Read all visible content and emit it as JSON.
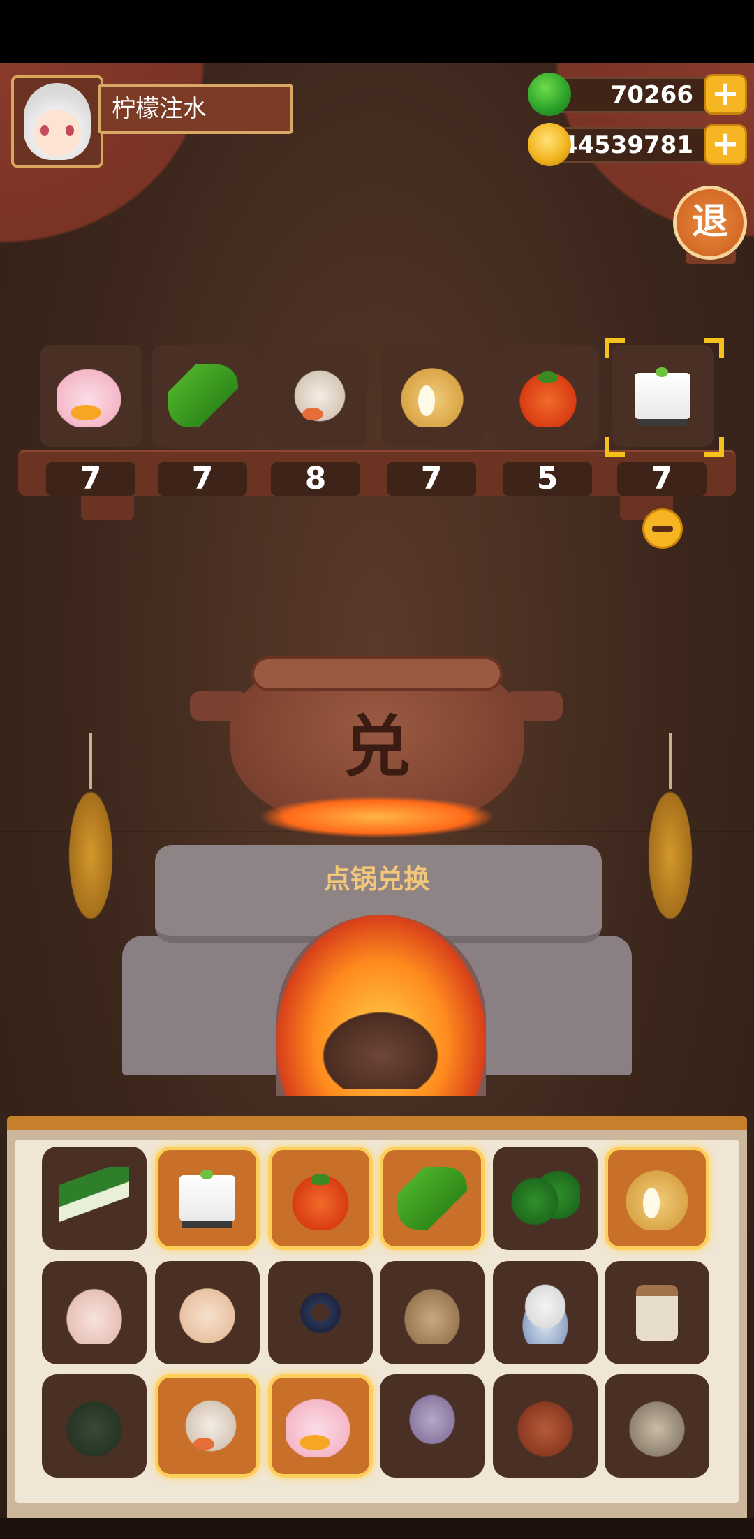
{
  "player": {
    "name": "柠檬注水"
  },
  "currency": {
    "gems": "70266",
    "coins": "44539781",
    "add_symbol": "+"
  },
  "exit_label": "退",
  "selected": [
    {
      "icon": "duck-icon",
      "count": "7"
    },
    {
      "icon": "cucumber-icon",
      "count": "7"
    },
    {
      "icon": "shrimp-icon",
      "count": "8"
    },
    {
      "icon": "potato-icon",
      "count": "7"
    },
    {
      "icon": "tomato-icon",
      "count": "5"
    },
    {
      "icon": "tofu-icon",
      "count": "7"
    }
  ],
  "pot": {
    "symbol": "兑",
    "action_label": "点锅兑换"
  },
  "inventory": [
    {
      "icon": "leek-icon",
      "selected": false
    },
    {
      "icon": "tofu-icon",
      "selected": true
    },
    {
      "icon": "tomato-icon",
      "selected": true
    },
    {
      "icon": "cucumber-icon",
      "selected": true
    },
    {
      "icon": "green-pepper-icon",
      "selected": false
    },
    {
      "icon": "potato-icon",
      "selected": true
    },
    {
      "icon": "chicken-icon",
      "selected": false
    },
    {
      "icon": "egg-icon",
      "selected": false
    },
    {
      "icon": "eel-icon",
      "selected": false
    },
    {
      "icon": "grain-sack-icon",
      "selected": false
    },
    {
      "icon": "rice-bowl-icon",
      "selected": false
    },
    {
      "icon": "jar-icon",
      "selected": false
    },
    {
      "icon": "crab-icon",
      "selected": false
    },
    {
      "icon": "shrimp-icon",
      "selected": true
    },
    {
      "icon": "duck-icon",
      "selected": true
    },
    {
      "icon": "squid-icon",
      "selected": false
    },
    {
      "icon": "meat-icon",
      "selected": false
    },
    {
      "icon": "clam-icon",
      "selected": false
    }
  ],
  "colors": {
    "accent": "#f6b522",
    "selection": "#ffcf5c",
    "panel": "#4a3024"
  }
}
